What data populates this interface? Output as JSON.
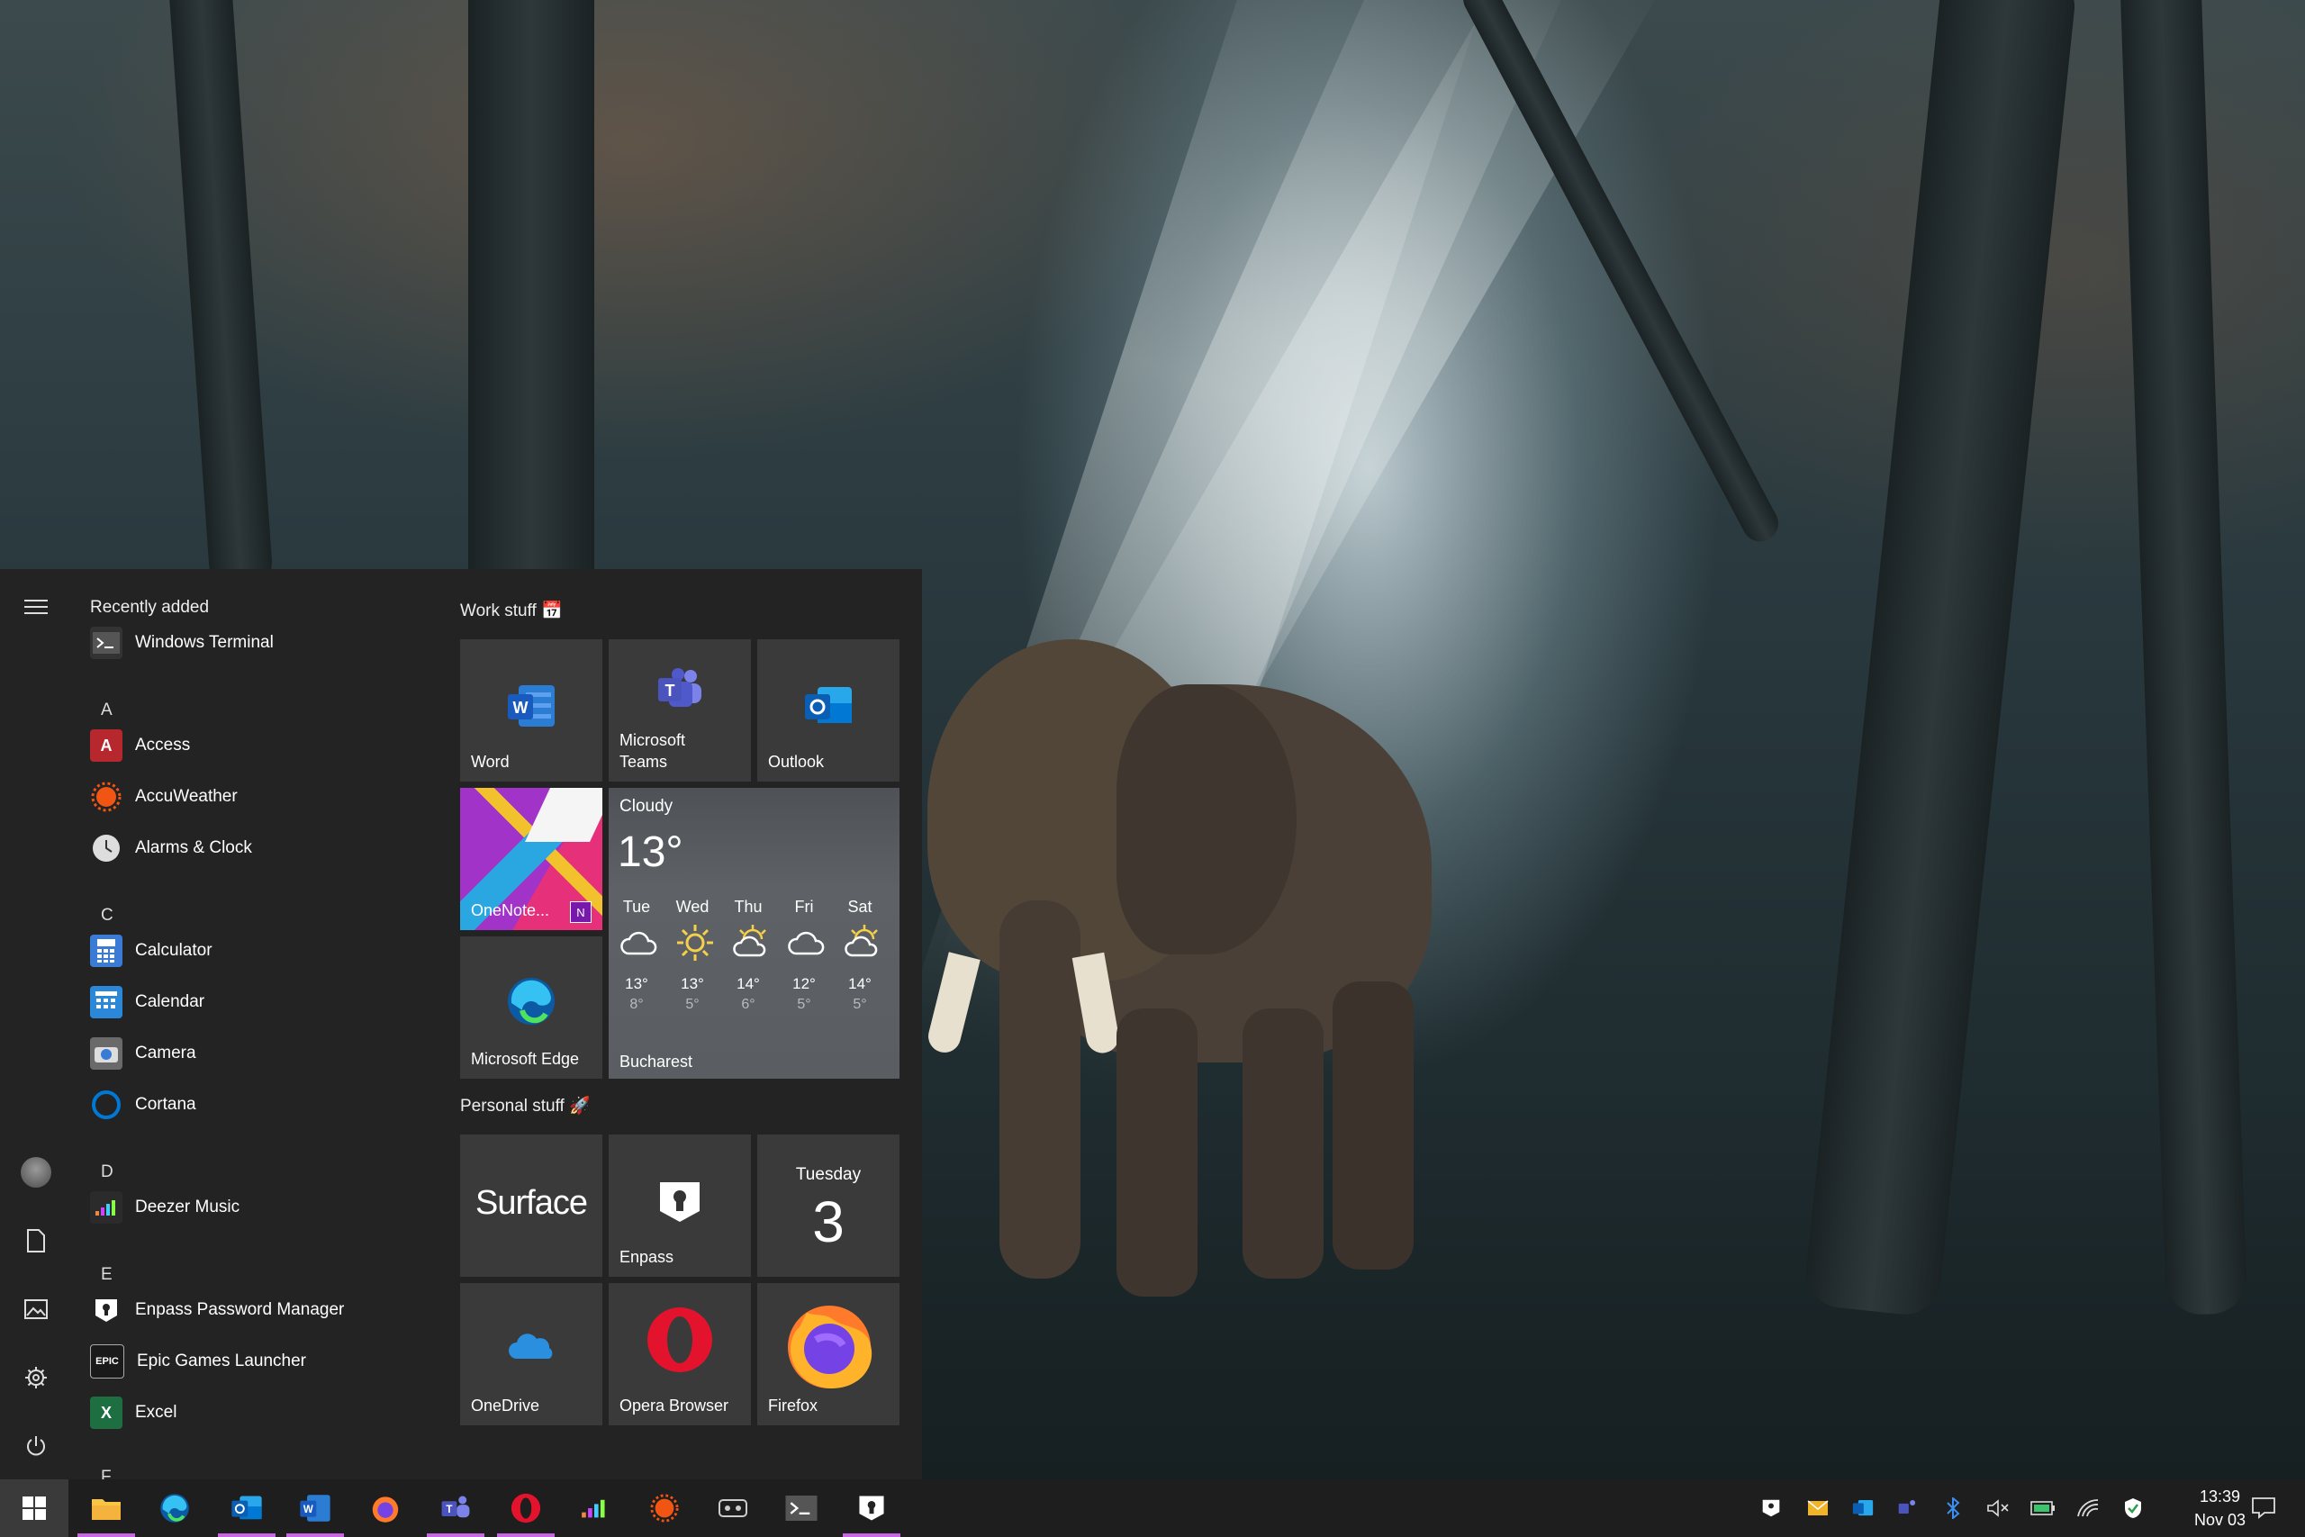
{
  "start_menu": {
    "recently_added": "Recently added",
    "apps": [
      {
        "name": "Windows Terminal",
        "icon": "terminal-icon",
        "color": "#333333"
      },
      {
        "letter": "A"
      },
      {
        "name": "Access",
        "icon": "access-icon",
        "color": "#b7282e"
      },
      {
        "name": "AccuWeather",
        "icon": "accuweather-icon",
        "color": "#f05514"
      },
      {
        "name": "Alarms & Clock",
        "icon": "clock-icon",
        "color": "#cccccc"
      },
      {
        "letter": "C"
      },
      {
        "name": "Calculator",
        "icon": "calculator-icon",
        "color": "#3a7bd5"
      },
      {
        "name": "Calendar",
        "icon": "calendar-icon",
        "color": "#2b88d8"
      },
      {
        "name": "Camera",
        "icon": "camera-icon",
        "color": "#6a6a6a"
      },
      {
        "name": "Cortana",
        "icon": "cortana-icon",
        "color": "#0078d4"
      },
      {
        "letter": "D"
      },
      {
        "name": "Deezer Music",
        "icon": "deezer-icon",
        "color": "#2b2b2b"
      },
      {
        "letter": "E"
      },
      {
        "name": "Enpass Password Manager",
        "icon": "enpass-icon",
        "color": "#ffffff"
      },
      {
        "name": "Epic Games Launcher",
        "icon": "epic-games-icon",
        "color": "#1a1a1a"
      },
      {
        "name": "Excel",
        "icon": "excel-icon",
        "color": "#1d6f42"
      },
      {
        "letter": "F"
      }
    ],
    "groups": {
      "work": {
        "title": "Work stuff 📅"
      },
      "personal": {
        "title": "Personal stuff 🚀"
      }
    },
    "tiles": {
      "word": "Word",
      "teams": "Microsoft Teams",
      "outlook": "Outlook",
      "onenote": "OneNote...",
      "edge": "Microsoft Edge",
      "surface": "Surface",
      "enpass": "Enpass",
      "onedrive": "OneDrive",
      "opera": "Opera Browser",
      "firefox": "Firefox"
    },
    "weather": {
      "condition": "Cloudy",
      "temp": "13°",
      "city": "Bucharest",
      "forecast": [
        {
          "day": "Tue",
          "hi": "13°",
          "lo": "8°",
          "icon": "cloud-icon"
        },
        {
          "day": "Wed",
          "hi": "13°",
          "lo": "5°",
          "icon": "sun-icon"
        },
        {
          "day": "Thu",
          "hi": "14°",
          "lo": "6°",
          "icon": "partly-sunny-icon"
        },
        {
          "day": "Fri",
          "hi": "12°",
          "lo": "5°",
          "icon": "cloud-icon"
        },
        {
          "day": "Sat",
          "hi": "14°",
          "lo": "5°",
          "icon": "partly-sunny-icon"
        }
      ]
    },
    "calendar_tile": {
      "weekday": "Tuesday",
      "day": "3"
    }
  },
  "taskbar": {
    "accent": "#c966e4",
    "apps": [
      {
        "icon": "start-icon"
      },
      {
        "icon": "file-explorer-icon",
        "active": true
      },
      {
        "icon": "edge-icon"
      },
      {
        "icon": "outlook-mail-icon",
        "active": true
      },
      {
        "icon": "word-icon",
        "active": true
      },
      {
        "icon": "firefox-icon"
      },
      {
        "icon": "teams-icon",
        "active": true
      },
      {
        "icon": "opera-icon",
        "active": true
      },
      {
        "icon": "deezer-icon"
      },
      {
        "icon": "accuweather-icon"
      },
      {
        "icon": "epic-games-icon"
      },
      {
        "icon": "terminal-icon"
      },
      {
        "icon": "enpass-icon",
        "active": true
      }
    ],
    "tray": [
      "enpass-tray-icon",
      "mail-tray-icon",
      "outlook-tray-icon",
      "teams-tray-icon",
      "bluetooth-icon",
      "volume-muted-icon",
      "battery-icon",
      "wifi-icon",
      "defender-icon"
    ],
    "clock": {
      "time": "13:39",
      "date": "Nov 03"
    }
  }
}
